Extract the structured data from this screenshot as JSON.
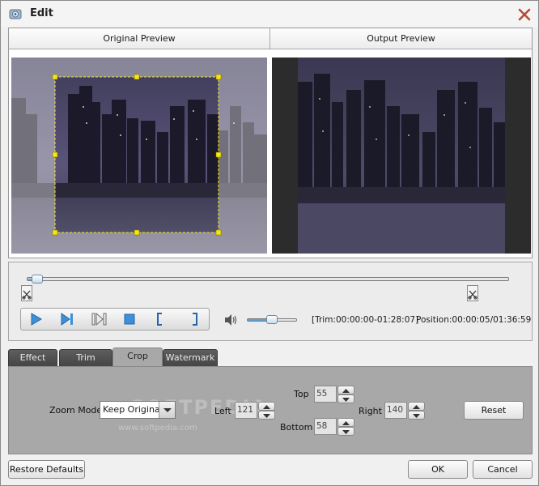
{
  "window": {
    "title": "Edit"
  },
  "preview": {
    "original_label": "Original Preview",
    "output_label": "Output Preview"
  },
  "timeline": {
    "progress": 0.009,
    "trim_text": "[Trim:00:00:00-01:28:07]",
    "position_text": "Position:00:00:05/01:36:59",
    "volume": 0.5
  },
  "tabs": [
    {
      "label": "Effect"
    },
    {
      "label": "Trim"
    },
    {
      "label": "Crop",
      "active": true
    },
    {
      "label": "Watermark"
    }
  ],
  "crop": {
    "zoom_mode_label": "Zoom Mode",
    "zoom_mode_value": "Keep Original",
    "top_label": "Top",
    "top_value": "55",
    "left_label": "Left",
    "left_value": "121",
    "right_label": "Right",
    "right_value": "140",
    "bottom_label": "Bottom",
    "bottom_value": "58",
    "reset_label": "Reset"
  },
  "watermark_text": "SOFTPEDIA",
  "watermark_sub": "www.softpedia.com",
  "footer": {
    "restore_label": "Restore Defaults",
    "ok_label": "OK",
    "cancel_label": "Cancel"
  },
  "colors": {
    "accent": "#3f8fd6",
    "panel": "#a8a8a8",
    "tab_dark": "#4f4f4f",
    "crop_frame": "#f5e61a"
  }
}
